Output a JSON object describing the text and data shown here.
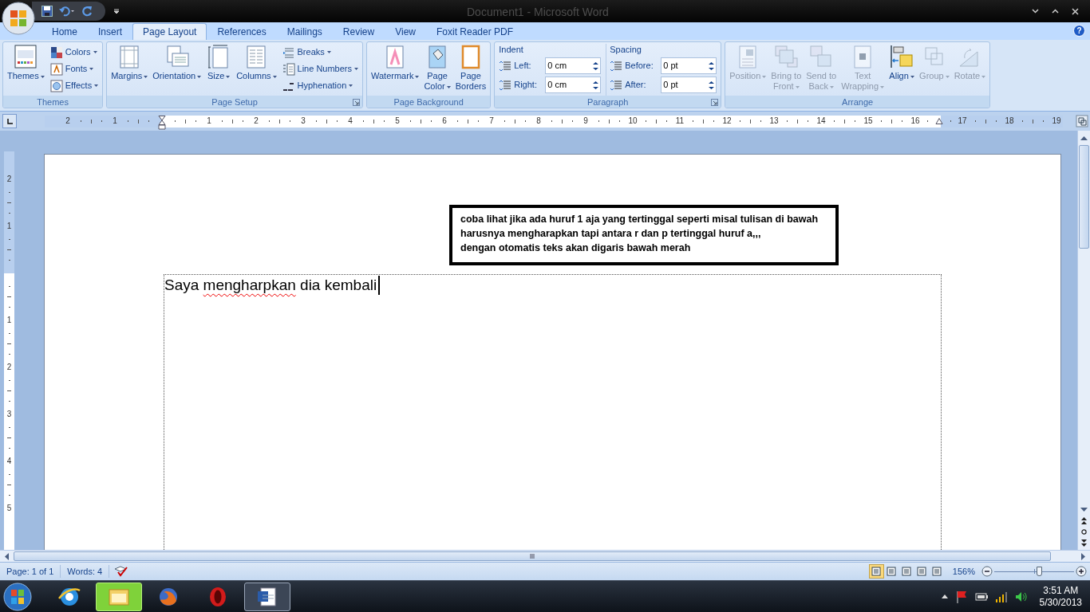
{
  "window": {
    "title": "Document1 - Microsoft Word",
    "help": "?"
  },
  "tabs": [
    {
      "label": "Home",
      "selected": false
    },
    {
      "label": "Insert",
      "selected": false
    },
    {
      "label": "Page Layout",
      "selected": true
    },
    {
      "label": "References",
      "selected": false
    },
    {
      "label": "Mailings",
      "selected": false
    },
    {
      "label": "Review",
      "selected": false
    },
    {
      "label": "View",
      "selected": false
    },
    {
      "label": "Foxit Reader PDF",
      "selected": false
    }
  ],
  "ribbon": {
    "groups": [
      {
        "kind": "buttons",
        "label": "Themes",
        "launcher": false,
        "items": [
          {
            "kind": "large",
            "label": "Themes",
            "dropdown": true,
            "disabled": false
          },
          {
            "kind": "small",
            "label": "Colors",
            "dropdown": true,
            "disabled": false
          },
          {
            "kind": "small",
            "label": "Fonts",
            "dropdown": true,
            "disabled": false
          },
          {
            "kind": "small",
            "label": "Effects",
            "dropdown": true,
            "disabled": false
          }
        ]
      },
      {
        "kind": "buttons",
        "label": "Page Setup",
        "launcher": true,
        "items": [
          {
            "kind": "large",
            "label": "Margins",
            "dropdown": true,
            "disabled": false
          },
          {
            "kind": "large",
            "label": "Orientation",
            "dropdown": true,
            "disabled": false
          },
          {
            "kind": "large",
            "label": "Size",
            "dropdown": true,
            "disabled": false
          },
          {
            "kind": "large",
            "label": "Columns",
            "dropdown": true,
            "disabled": false
          },
          {
            "kind": "small",
            "label": "Breaks",
            "dropdown": true,
            "disabled": false
          },
          {
            "kind": "small",
            "label": "Line Numbers",
            "dropdown": true,
            "disabled": false
          },
          {
            "kind": "small",
            "label": "Hyphenation",
            "dropdown": true,
            "disabled": false
          }
        ]
      },
      {
        "kind": "buttons",
        "label": "Page Background",
        "launcher": false,
        "items": [
          {
            "kind": "large",
            "label": "Watermark",
            "dropdown": true,
            "disabled": false
          },
          {
            "kind": "large",
            "label": "Page\nColor",
            "dropdown": true,
            "disabled": false
          },
          {
            "kind": "large",
            "label": "Page\nBorders",
            "dropdown": false,
            "disabled": false
          }
        ]
      },
      {
        "kind": "paragraph",
        "label": "Paragraph",
        "launcher": true,
        "sections": [
          {
            "heading": "Indent",
            "fields": [
              {
                "label": "Left:",
                "value": "0 cm"
              },
              {
                "label": "Right:",
                "value": "0 cm"
              }
            ]
          },
          {
            "heading": "Spacing",
            "fields": [
              {
                "label": "Before:",
                "value": "0 pt"
              },
              {
                "label": "After:",
                "value": "0 pt"
              }
            ]
          }
        ]
      },
      {
        "kind": "buttons",
        "label": "Arrange",
        "launcher": false,
        "items": [
          {
            "kind": "large",
            "label": "Position",
            "dropdown": true,
            "disabled": true
          },
          {
            "kind": "large",
            "label": "Bring to\nFront",
            "dropdown": true,
            "disabled": true
          },
          {
            "kind": "large",
            "label": "Send to\nBack",
            "dropdown": true,
            "disabled": true
          },
          {
            "kind": "large",
            "label": "Text\nWrapping",
            "dropdown": true,
            "disabled": true
          },
          {
            "kind": "large",
            "label": "Align",
            "dropdown": true,
            "disabled": false
          },
          {
            "kind": "large",
            "label": "Group",
            "dropdown": true,
            "disabled": true
          },
          {
            "kind": "large",
            "label": "Rotate",
            "dropdown": true,
            "disabled": true
          }
        ]
      }
    ]
  },
  "horizontal_ruler": {
    "left_labels": [
      "2",
      "1"
    ],
    "labels": [
      "1",
      "2",
      "3",
      "4",
      "5",
      "6",
      "7",
      "8",
      "9",
      "10",
      "11",
      "12",
      "13",
      "14",
      "15",
      "16",
      "17",
      "18",
      "19"
    ]
  },
  "vertical_ruler": {
    "top_labels": [
      "2",
      "1"
    ],
    "labels": [
      "1",
      "2",
      "3",
      "4",
      "5"
    ]
  },
  "document": {
    "callout": {
      "lines": [
        "coba lihat jika ada huruf 1 aja yang tertinggal seperti misal tulisan di bawah",
        "harusnya mengharapkan tapi antara r dan p tertinggal huruf a,,,",
        "dengan otomatis teks akan digaris bawah merah"
      ]
    },
    "body": {
      "words": [
        {
          "text": "Saya",
          "misspelled": false
        },
        {
          "text": "mengharpkan",
          "misspelled": true
        },
        {
          "text": "dia",
          "misspelled": false
        },
        {
          "text": "kembali",
          "misspelled": false
        }
      ]
    }
  },
  "status_bar": {
    "page": "Page: 1 of 1",
    "words": "Words: 4",
    "views": [
      {
        "selected": true
      },
      {
        "selected": false
      },
      {
        "selected": false
      },
      {
        "selected": false
      },
      {
        "selected": false
      }
    ],
    "zoom": "156%",
    "zoom_slider": {
      "level": 0.56
    }
  },
  "taskbar": {
    "apps": [
      {
        "selected": false,
        "highlighted": false
      },
      {
        "selected": false,
        "highlighted": true
      },
      {
        "selected": false,
        "highlighted": false
      },
      {
        "selected": false,
        "highlighted": false
      },
      {
        "selected": true,
        "highlighted": false
      }
    ],
    "time": "3:51 AM",
    "date": "5/30/2013"
  }
}
